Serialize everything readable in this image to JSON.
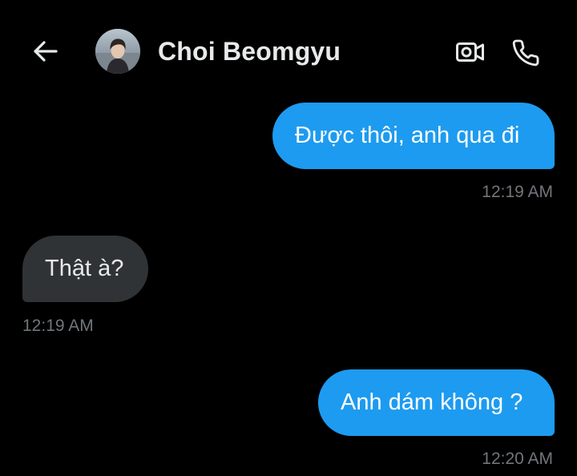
{
  "header": {
    "contact_name": "Choi Beomgyu"
  },
  "colors": {
    "background": "#000000",
    "sent_bubble": "#1d9bf0",
    "received_bubble": "#2f3336",
    "timestamp": "#71767b",
    "text": "#e7e9ea"
  },
  "icons": {
    "back": "arrow-left-icon",
    "video": "video-camera-icon",
    "call": "phone-icon"
  },
  "messages": [
    {
      "direction": "sent",
      "text": "Được thôi, anh qua đi",
      "time": "12:19 AM"
    },
    {
      "direction": "received",
      "text": "Thật à?",
      "time": "12:19 AM"
    },
    {
      "direction": "sent",
      "text": "Anh dám không ?",
      "time": "12:20 AM"
    }
  ]
}
